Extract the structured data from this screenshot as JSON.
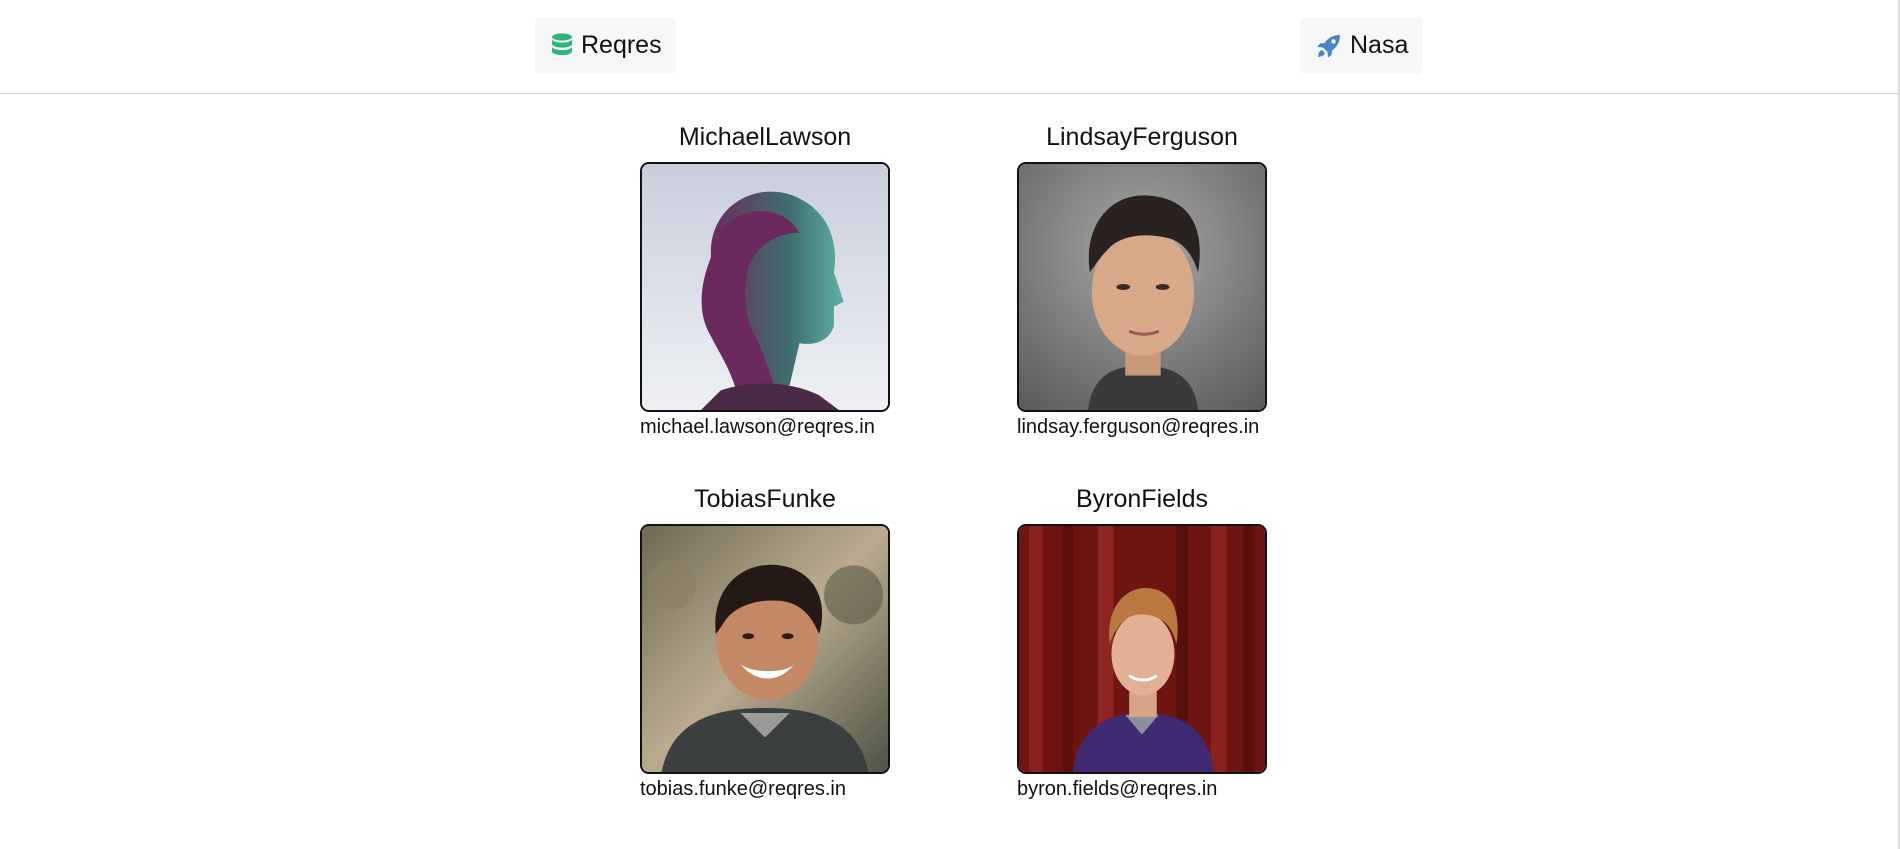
{
  "nav": {
    "reqres": {
      "label": "Reqres",
      "icon": "database-icon",
      "icon_color": "#2fb67c"
    },
    "nasa": {
      "label": "Nasa",
      "icon": "rocket-icon",
      "icon_color": "#4a86c7"
    }
  },
  "users": [
    {
      "name": "MichaelLawson",
      "email": "michael.lawson@reqres.in"
    },
    {
      "name": "LindsayFerguson",
      "email": "lindsay.ferguson@reqres.in"
    },
    {
      "name": "TobiasFunke",
      "email": "tobias.funke@reqres.in"
    },
    {
      "name": "ByronFields",
      "email": "byron.fields@reqres.in"
    }
  ]
}
